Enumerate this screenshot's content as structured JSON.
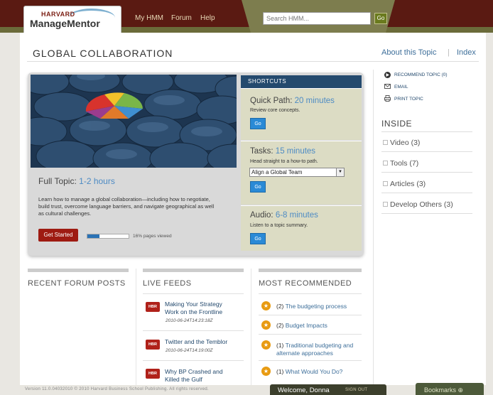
{
  "header": {
    "logo_line1": "HARVARD",
    "logo_line2": "ManageMentor",
    "nav": [
      "My HMM",
      "Forum",
      "Help"
    ],
    "search_placeholder": "Search HMM...",
    "search_go": "Go"
  },
  "page": {
    "title": "GLOBAL COLLABORATION",
    "about_link": "About this Topic",
    "separator": "|",
    "index_link": "Index"
  },
  "hero": {
    "full_topic_label": "Full Topic:",
    "full_topic_time": "1-2 hours",
    "description": "Learn how to manage a global collaboration—including how to negotiate, build trust, overcome language barriers, and navigate geographical as well as cultural challenges.",
    "get_started": "Get Started",
    "progress_fraction": 0.3,
    "pages_viewed": "16% pages viewed"
  },
  "shortcuts": {
    "header": "SHORTCUTS",
    "quick": {
      "label": "Quick Path:",
      "time": "20 minutes",
      "sub": "Review core concepts.",
      "go": "Go"
    },
    "tasks": {
      "label": "Tasks:",
      "time": "15 minutes",
      "sub": "Head straight to a how-to path.",
      "selected": "Align a Global Team",
      "go": "Go"
    },
    "audio": {
      "label": "Audio:",
      "time": "6-8 minutes",
      "sub": "Listen to a topic summary.",
      "go": "Go"
    }
  },
  "rail": {
    "recommend": "RECOMMEND TOPIC (0)",
    "email": "EMAIL",
    "print": "PRINT TOPIC",
    "inside_title": "INSIDE",
    "inside_items": [
      "Video (3)",
      "Tools (7)",
      "Articles (3)",
      "Develop Others (3)"
    ]
  },
  "columns": {
    "forum_title": "RECENT FORUM POSTS",
    "feeds_title": "LIVE FEEDS",
    "recommended_title": "MOST RECOMMENDED",
    "feeds": [
      {
        "badge": "HBR",
        "title": "Making Your Strategy Work on the Frontline",
        "date": "2010-06-24T14:23:18Z"
      },
      {
        "badge": "HBR",
        "title": "Twitter and the Temblor",
        "date": "2010-06-24T14:19:00Z"
      },
      {
        "badge": "HBR",
        "title": "Why BP Crashed and Killed the Gulf",
        "date": ""
      }
    ],
    "recommended": [
      {
        "count": "(2)",
        "title": "The budgeting process"
      },
      {
        "count": "(2)",
        "title": "Budget Impacts"
      },
      {
        "count": "(1)",
        "title": "Traditional budgeting and alternate approaches"
      },
      {
        "count": "(1)",
        "title": "What Would You Do?"
      }
    ]
  },
  "footer": {
    "version": "Version 11.0.04032010 © 2010 Harvard Business School Publishing. All rights reserved.",
    "welcome": "Welcome, Donna",
    "signout": "SIGN OUT",
    "bookmarks": "Bookmarks"
  },
  "colors": {
    "header_bg": "#5a1a12",
    "accent_blue": "#4d8bc4",
    "shortcut_head": "#244a6e",
    "button_red": "#9e1b12",
    "go_blue": "#2a8ad6",
    "star_orange": "#e89b12"
  }
}
